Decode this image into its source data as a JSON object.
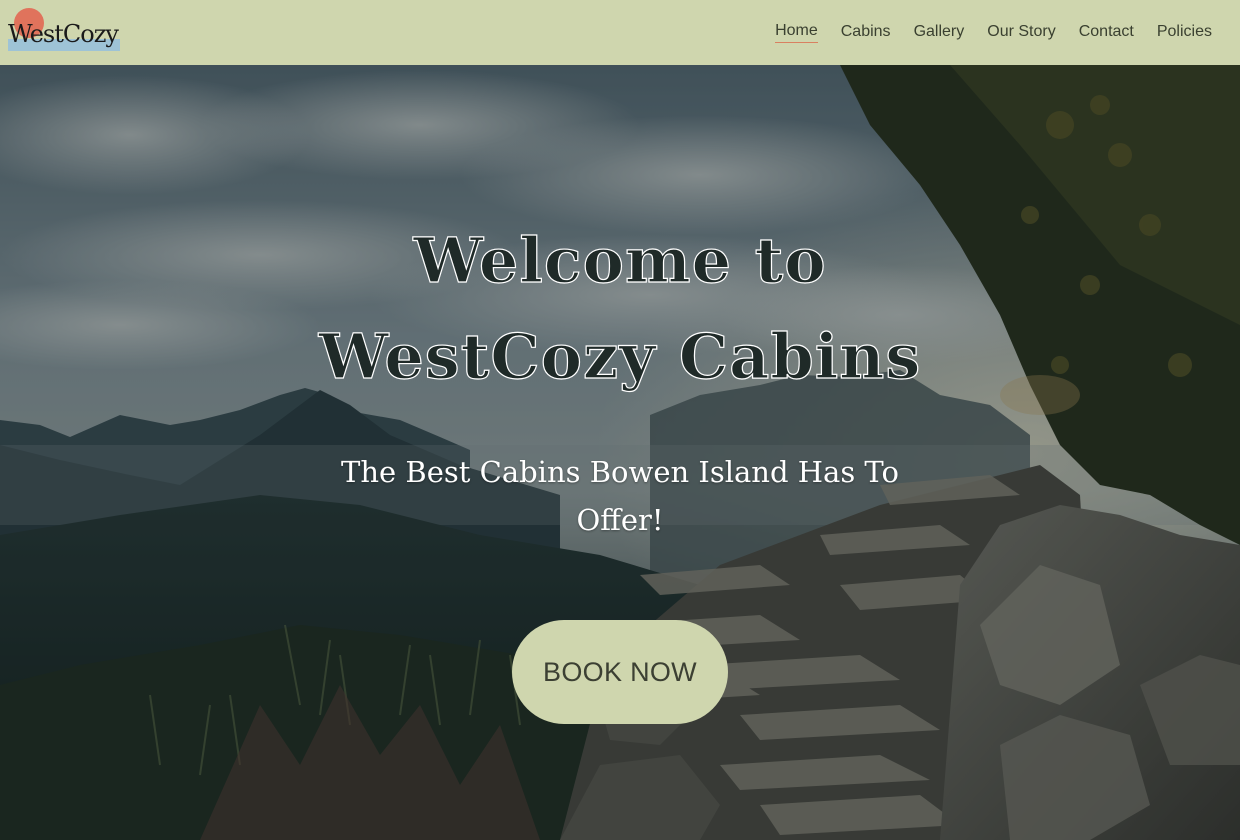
{
  "brand": {
    "logo_text": "WestCozy",
    "colors": {
      "header_bg": "#cfd6ae",
      "logo_dot": "#e0735c",
      "logo_bar": "#9ec3d6",
      "nav_underline": "#d98060",
      "button_bg": "#cfd6ae"
    }
  },
  "nav": {
    "items": [
      {
        "label": "Home",
        "active": true
      },
      {
        "label": "Cabins"
      },
      {
        "label": "Gallery"
      },
      {
        "label": "Our Story"
      },
      {
        "label": "Contact"
      },
      {
        "label": "Policies"
      }
    ]
  },
  "hero": {
    "title_line1": "Welcome to",
    "title_line2": "WestCozy Cabins",
    "subtitle": "The Best Cabins Bowen Island Has To Offer!",
    "cta_label": "BOOK NOW",
    "background": "mountain-trail-photo"
  }
}
